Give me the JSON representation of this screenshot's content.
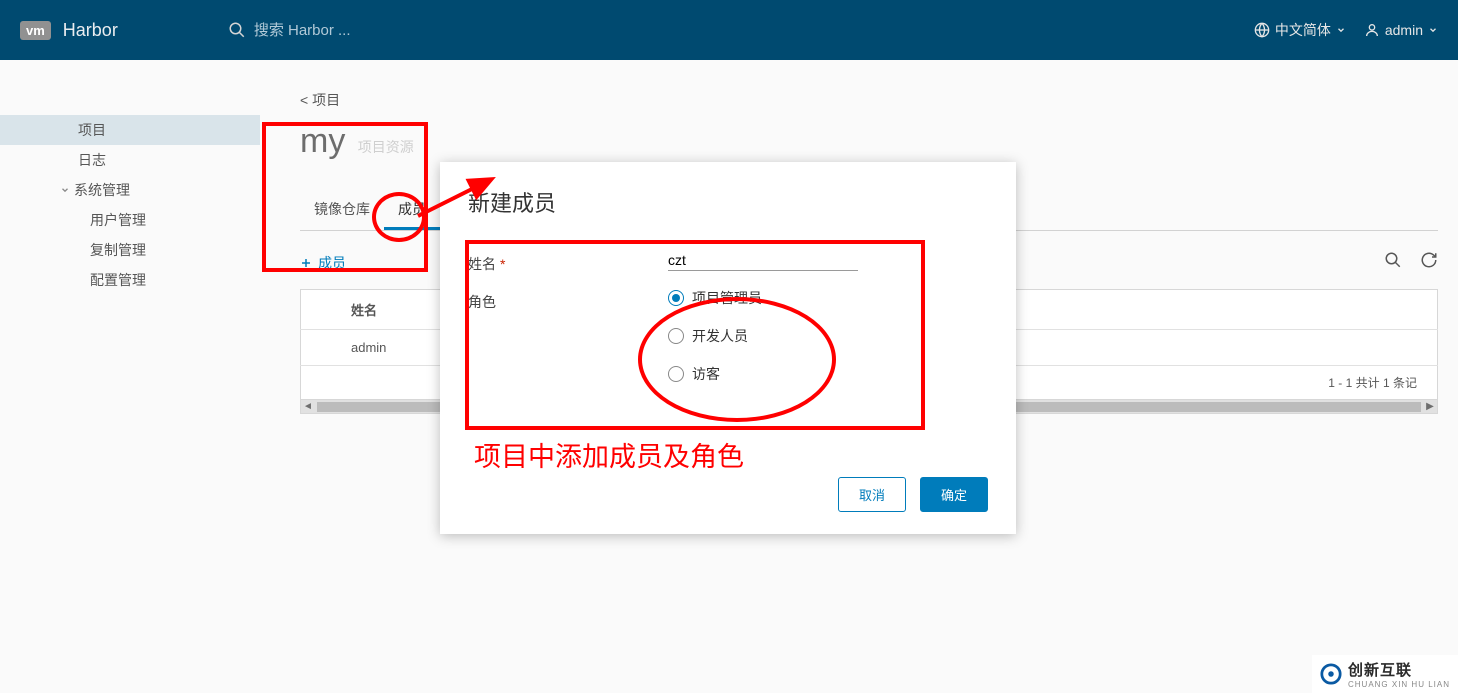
{
  "header": {
    "logo_text": "vm",
    "app_name": "Harbor",
    "search_placeholder": "搜索 Harbor ...",
    "language_label": "中文简体",
    "user_label": "admin"
  },
  "sidebar": {
    "items": [
      {
        "label": "项目"
      },
      {
        "label": "日志"
      }
    ],
    "admin_group": "系统管理",
    "admin_subs": [
      {
        "label": "用户管理"
      },
      {
        "label": "复制管理"
      },
      {
        "label": "配置管理"
      }
    ]
  },
  "main": {
    "back_label": "< 项目",
    "project_name": "my",
    "project_sub": "项目资源",
    "tabs": [
      {
        "label": "镜像仓库"
      },
      {
        "label": "成员"
      }
    ],
    "add_member": "成员",
    "table": {
      "header": "姓名",
      "rows": [
        {
          "name": "admin"
        }
      ]
    },
    "pager_text": "1 - 1 共计 1 条记"
  },
  "modal": {
    "title": "新建成员",
    "name_label": "姓名",
    "name_value": "czt",
    "role_label": "角色",
    "roles": [
      {
        "label": "项目管理员",
        "checked": true
      },
      {
        "label": "开发人员",
        "checked": false
      },
      {
        "label": "访客",
        "checked": false
      }
    ],
    "cancel": "取消",
    "ok": "确定"
  },
  "annotation_text": "项目中添加成员及角色",
  "watermark": {
    "main": "创新互联",
    "sub": "CHUANG XIN HU LIAN"
  }
}
